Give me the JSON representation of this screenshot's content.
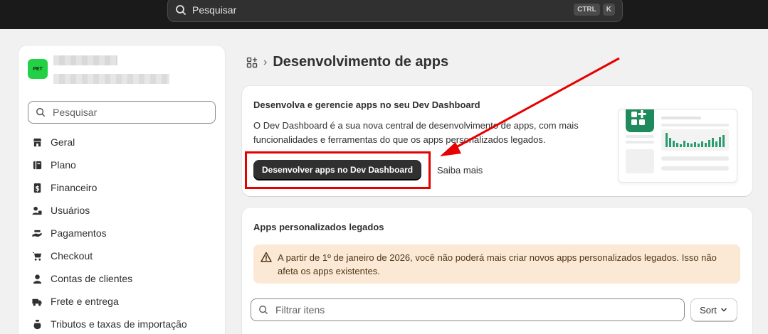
{
  "topbar": {
    "search_placeholder": "Pesquisar",
    "shortcut_1": "CTRL",
    "shortcut_2": "K"
  },
  "sidebar": {
    "store_logo_text": "PET",
    "search_placeholder": "Pesquisar",
    "items": [
      {
        "label": "Geral",
        "icon": "store-icon"
      },
      {
        "label": "Plano",
        "icon": "plan-icon"
      },
      {
        "label": "Financeiro",
        "icon": "dollar-icon"
      },
      {
        "label": "Usuários",
        "icon": "users-icon"
      },
      {
        "label": "Pagamentos",
        "icon": "payment-hand-icon"
      },
      {
        "label": "Checkout",
        "icon": "cart-icon"
      },
      {
        "label": "Contas de clientes",
        "icon": "person-icon"
      },
      {
        "label": "Frete e entrega",
        "icon": "truck-icon"
      },
      {
        "label": "Tributos e taxas de importação",
        "icon": "tax-icon"
      }
    ]
  },
  "header": {
    "breadcrumb_icon": "apps-icon",
    "title": "Desenvolvimento de apps"
  },
  "dev_card": {
    "title": "Desenvolva e gerencie apps no seu Dev Dashboard",
    "body": "O Dev Dashboard é a sua nova central de desenvolvimento de apps, com mais funcionalidades e ferramentas do que os apps personalizados legados.",
    "primary_button": "Desenvolver apps no Dev Dashboard",
    "secondary_link": "Saiba mais"
  },
  "legacy_card": {
    "title": "Apps personalizados legados",
    "warning": "A partir de 1º de janeiro de 2026, você não poderá mais criar novos apps personalizados legados. Isso não afeta os apps existentes.",
    "filter_placeholder": "Filtrar itens",
    "sort_label": "Sort"
  },
  "colors": {
    "topbar": "#1a1a1a",
    "store_logo": "#22d244",
    "illustration_accent": "#1f8a5b",
    "annotation": "#e60000",
    "warning_bg": "#fbe9d6"
  }
}
